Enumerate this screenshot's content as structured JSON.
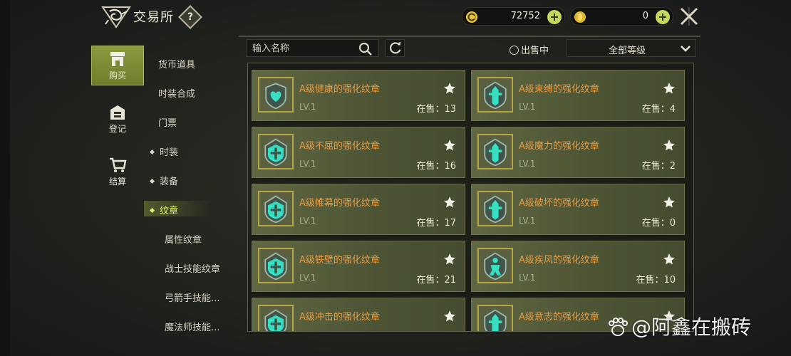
{
  "header": {
    "title": "交易所",
    "help": "?"
  },
  "currency": [
    {
      "name": "coin-icon",
      "value": "72752",
      "color": "#e4c33a"
    },
    {
      "name": "gold-icon",
      "value": "0",
      "color": "#e0b830"
    }
  ],
  "nav": [
    {
      "label": "购买",
      "icon": "shop-icon",
      "active": true
    },
    {
      "label": "登记",
      "icon": "register-icon",
      "active": false
    },
    {
      "label": "结算",
      "icon": "cart-icon",
      "active": false
    }
  ],
  "categories": [
    {
      "label": "货币道具",
      "dot": false,
      "indent": false,
      "active": false
    },
    {
      "label": "时装合成",
      "dot": false,
      "indent": false,
      "active": false
    },
    {
      "label": "门票",
      "dot": false,
      "indent": false,
      "active": false
    },
    {
      "label": "时装",
      "dot": true,
      "indent": false,
      "active": false
    },
    {
      "label": "装备",
      "dot": true,
      "indent": false,
      "active": false
    },
    {
      "label": "纹章",
      "dot": true,
      "indent": false,
      "active": true
    },
    {
      "label": "属性纹章",
      "dot": false,
      "indent": true,
      "active": false
    },
    {
      "label": "战士技能纹章",
      "dot": false,
      "indent": true,
      "active": false
    },
    {
      "label": "弓箭手技能...",
      "dot": false,
      "indent": true,
      "active": false
    },
    {
      "label": "魔法师技能...",
      "dot": false,
      "indent": true,
      "active": false
    }
  ],
  "search": {
    "placeholder": "输入名称"
  },
  "filter": {
    "on_sale_label": "出售中",
    "grade_label": "全部等级"
  },
  "items": [
    {
      "name": "A级健康的强化纹章",
      "level": "LV.1",
      "stock": "在售：13",
      "emblem": "heart"
    },
    {
      "name": "A级束缚的强化纹章",
      "level": "LV.1",
      "stock": "在售：4",
      "emblem": "knight"
    },
    {
      "name": "A级不屈的强化纹章",
      "level": "LV.1",
      "stock": "在售：16",
      "emblem": "cross"
    },
    {
      "name": "A级魔力的强化纹章",
      "level": "LV.1",
      "stock": "在售：2",
      "emblem": "knight"
    },
    {
      "name": "A级帷幕的强化纹章",
      "level": "LV.1",
      "stock": "在售：17",
      "emblem": "cross"
    },
    {
      "name": "A级破坏的强化纹章",
      "level": "LV.1",
      "stock": "在售：0",
      "emblem": "knight"
    },
    {
      "name": "A级铁壁的强化纹章",
      "level": "LV.1",
      "stock": "在售：21",
      "emblem": "cross"
    },
    {
      "name": "A级疾风的强化纹章",
      "level": "LV.1",
      "stock": "在售：10",
      "emblem": "figure"
    },
    {
      "name": "A级冲击的强化纹章",
      "level": "",
      "stock": "",
      "emblem": "cross"
    },
    {
      "name": "A级意志的强化纹章",
      "level": "",
      "stock": "",
      "emblem": "knight"
    }
  ],
  "watermark": "@阿鑫在搬砖",
  "colors": {
    "accent": "#c5d65a",
    "item_name": "#ef9b3c",
    "active_category": "#e2f06a"
  }
}
